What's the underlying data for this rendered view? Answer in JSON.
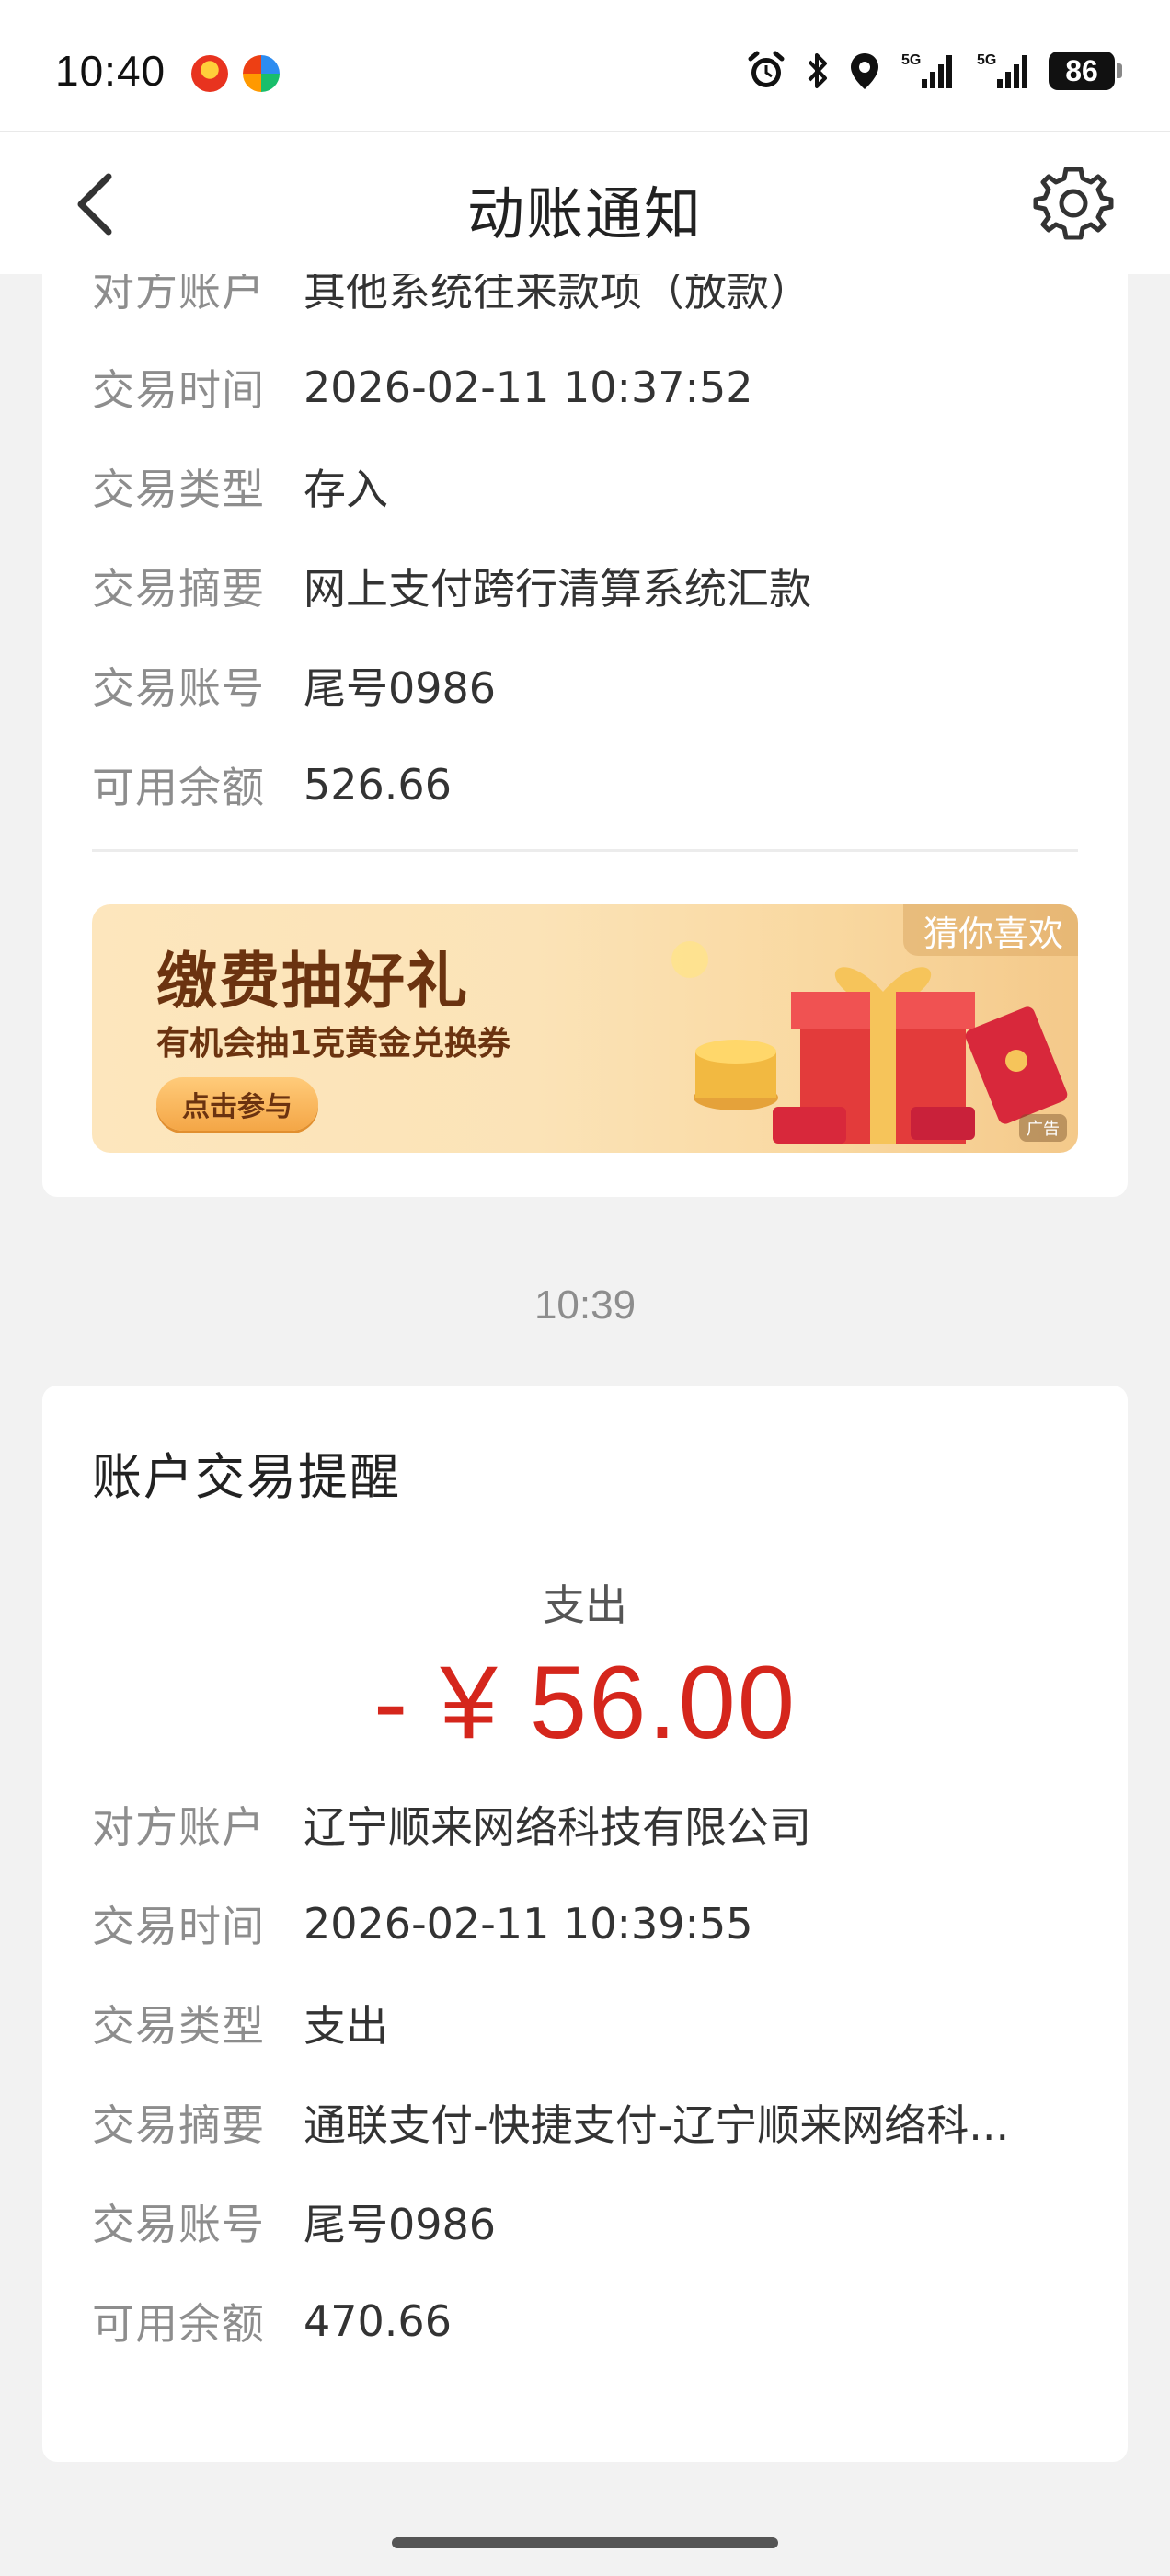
{
  "status_bar": {
    "time": "10:40",
    "icons": [
      "app-notification-icon",
      "app-notification-icon-2",
      "alarm-icon",
      "bluetooth-icon",
      "location-icon",
      "signal-5g-icon",
      "signal-5g-icon-2"
    ],
    "battery": "86"
  },
  "nav": {
    "title": "动账通知",
    "back_icon": "back-chevron-icon",
    "settings_icon": "gear-icon"
  },
  "card1": {
    "rows": [
      {
        "label": "对方账户",
        "value": "其他系统往来款项（放款）"
      },
      {
        "label": "交易时间",
        "value": "2026-02-11 10:37:52"
      },
      {
        "label": "交易类型",
        "value": "存入"
      },
      {
        "label": "交易摘要",
        "value": "网上支付跨行清算系统汇款"
      },
      {
        "label": "交易账号",
        "value": "尾号0986"
      },
      {
        "label": "可用余额",
        "value": "526.66"
      }
    ],
    "banner": {
      "title": "缴费抽好礼",
      "subtitle": "有机会抽1克黄金兑换券",
      "button": "点击参与",
      "tag": "猜你喜欢",
      "ad_label": "广告"
    }
  },
  "timestamp": "10:39",
  "card2": {
    "title": "账户交易提醒",
    "type": "支出",
    "amount": "- ¥ 56.00",
    "amount_color": "#d5261c",
    "rows": [
      {
        "label": "对方账户",
        "value": "辽宁顺来网络科技有限公司"
      },
      {
        "label": "交易时间",
        "value": "2026-02-11 10:39:55"
      },
      {
        "label": "交易类型",
        "value": "支出"
      },
      {
        "label": "交易摘要",
        "value": "通联支付-快捷支付-辽宁顺来网络科..."
      },
      {
        "label": "交易账号",
        "value": "尾号0986"
      },
      {
        "label": "可用余额",
        "value": "470.66"
      }
    ]
  }
}
